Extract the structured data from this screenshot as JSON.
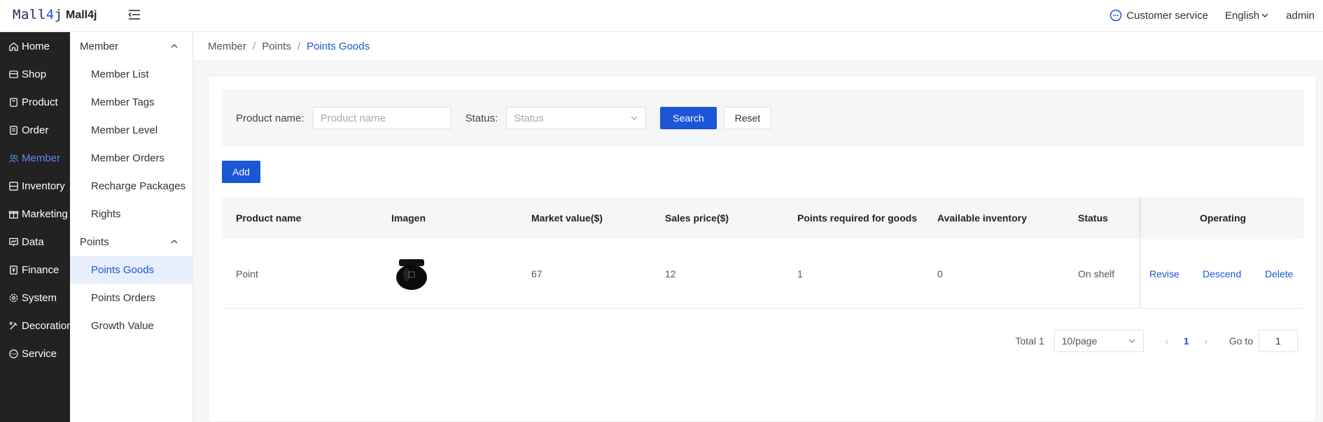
{
  "header": {
    "logo_text": "Mall4j",
    "app_name": "Mall4j",
    "customer_service": "Customer service",
    "language": "English",
    "user": "admin"
  },
  "sidebar": {
    "items": [
      {
        "label": "Home",
        "icon": "home-icon"
      },
      {
        "label": "Shop",
        "icon": "shop-icon"
      },
      {
        "label": "Product",
        "icon": "product-icon"
      },
      {
        "label": "Order",
        "icon": "order-icon"
      },
      {
        "label": "Member",
        "icon": "member-icon",
        "active": true
      },
      {
        "label": "Inventory",
        "icon": "inventory-icon"
      },
      {
        "label": "Marketing",
        "icon": "marketing-icon"
      },
      {
        "label": "Data",
        "icon": "data-icon"
      },
      {
        "label": "Finance",
        "icon": "finance-icon"
      },
      {
        "label": "System",
        "icon": "system-icon"
      },
      {
        "label": "Decoration",
        "icon": "decoration-icon"
      },
      {
        "label": "Service",
        "icon": "service-icon"
      }
    ]
  },
  "submenu": {
    "member_group": "Member",
    "member_items": [
      "Member List",
      "Member Tags",
      "Member Level",
      "Member Orders",
      "Recharge Packages",
      "Rights"
    ],
    "points_group": "Points",
    "points_items": [
      "Points Goods",
      "Points Orders",
      "Growth Value"
    ],
    "active_item": "Points Goods"
  },
  "breadcrumb": [
    "Member",
    "Points",
    "Points Goods"
  ],
  "search": {
    "product_name_label": "Product name:",
    "product_name_placeholder": "Product name",
    "status_label": "Status:",
    "status_placeholder": "Status",
    "search_button": "Search",
    "reset_button": "Reset"
  },
  "add_button": "Add",
  "table": {
    "columns": [
      "Product name",
      "Imagen",
      "Market value($)",
      "Sales price($)",
      "Points required for goods",
      "Available inventory",
      "Status",
      "Operating"
    ],
    "rows": [
      {
        "product_name": "Point",
        "image": "black-cream-jar-image",
        "market_value": "67",
        "sales_price": "12",
        "points_required": "1",
        "available_inventory": "0",
        "status": "On shelf",
        "actions": [
          "Revise",
          "Descend",
          "Delete"
        ]
      }
    ]
  },
  "pagination": {
    "total": "Total 1",
    "page_size": "10/page",
    "current_page": "1",
    "goto_label": "Go to",
    "goto_value": "1"
  },
  "colors": {
    "primary": "#1a56d6",
    "sidebar_bg": "#222222",
    "active_submenu_bg": "#e8effc"
  }
}
